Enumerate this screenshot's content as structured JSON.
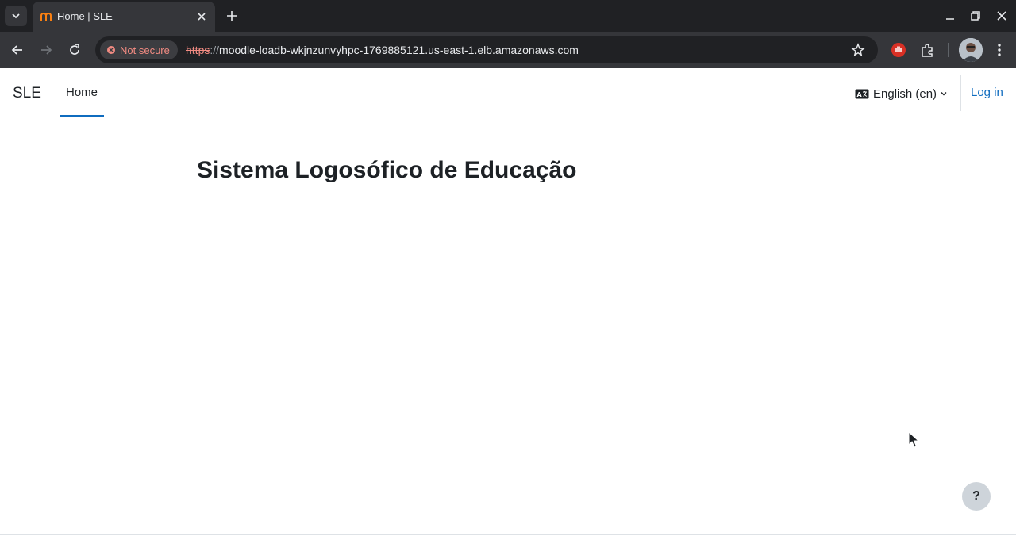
{
  "browser": {
    "tab": {
      "title": "Home | SLE"
    },
    "address": {
      "security_label": "Not secure",
      "scheme": "https",
      "separator": "://",
      "host": "moodle-loadb-wkjnzunvyhpc-1769885121.us-east-1.elb.amazonaws.com"
    },
    "colors": {
      "frame": "#202124",
      "toolbar": "#35363a",
      "insecure": "#f28b82"
    }
  },
  "navbar": {
    "brand": "SLE",
    "home_label": "Home",
    "language_label": "English (en)",
    "login_label": "Log in"
  },
  "main": {
    "site_title": "Sistema Logosófico de Educação"
  },
  "help_button": {
    "label": "?"
  },
  "colors": {
    "accent": "#0f6cbf",
    "text": "#1d2125",
    "border": "#dee2e6"
  }
}
